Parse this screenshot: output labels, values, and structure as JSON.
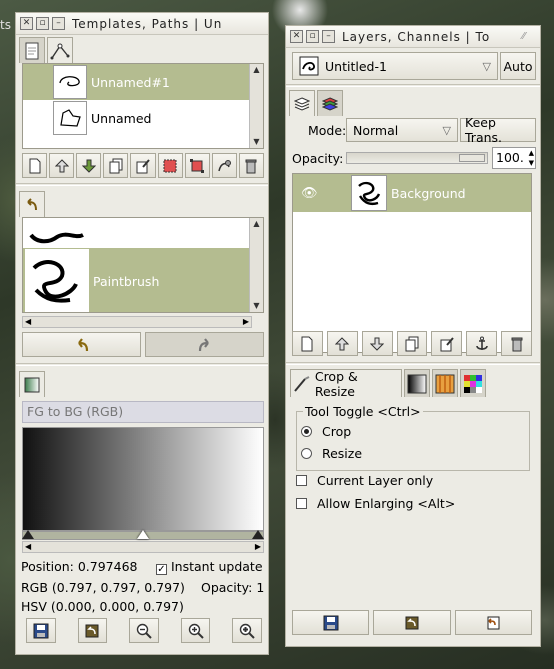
{
  "desktop": {
    "edge_text": "ts"
  },
  "templates_window": {
    "title": "Templates, Paths | Un",
    "paths": [
      {
        "name": "Unnamed#1",
        "selected": true
      },
      {
        "name": "Unnamed",
        "selected": false
      }
    ],
    "path_buttons": [
      "new-path-icon",
      "raise-icon",
      "lower-icon",
      "duplicate-icon",
      "edit-icon",
      "path-to-selection-icon",
      "selection-to-path-icon",
      "stroke-icon",
      "delete-icon"
    ],
    "undo": {
      "items": [
        {
          "name": "",
          "selected": false
        },
        {
          "name": "Paintbrush",
          "selected": true
        }
      ]
    },
    "gradient": {
      "name": "FG to BG (RGB)",
      "position_text": "Position: 0.797468",
      "instant_update_label": "Instant update",
      "instant_update_checked": true,
      "rgb_text": "RGB (0.797, 0.797, 0.797)",
      "opacity_text": "Opacity: 1",
      "hsv_text": "HSV (0.000, 0.000, 0.797)"
    }
  },
  "layers_window": {
    "title": "Layers, Channels | To",
    "image_name": "Untitled-1",
    "auto_label": "Auto",
    "mode_label": "Mode:",
    "mode_value": "Normal",
    "keep_trans_label": "Keep Trans.",
    "opacity_label": "Opacity:",
    "opacity_value": "100.",
    "layers": [
      {
        "name": "Background",
        "visible": true,
        "selected": true
      }
    ],
    "tool_tab_label": "Crop & Resize",
    "tool_options": {
      "toggle_label": "Tool Toggle  <Ctrl>",
      "radio": [
        {
          "label": "Crop",
          "checked": true
        },
        {
          "label": "Resize",
          "checked": false
        }
      ],
      "checks": [
        {
          "label": "Current Layer only",
          "checked": false
        },
        {
          "label": "Allow Enlarging  <Alt>",
          "checked": false
        }
      ]
    }
  },
  "colors": {
    "selection": "#b4bc90",
    "window_bg": "#ecebe4"
  }
}
